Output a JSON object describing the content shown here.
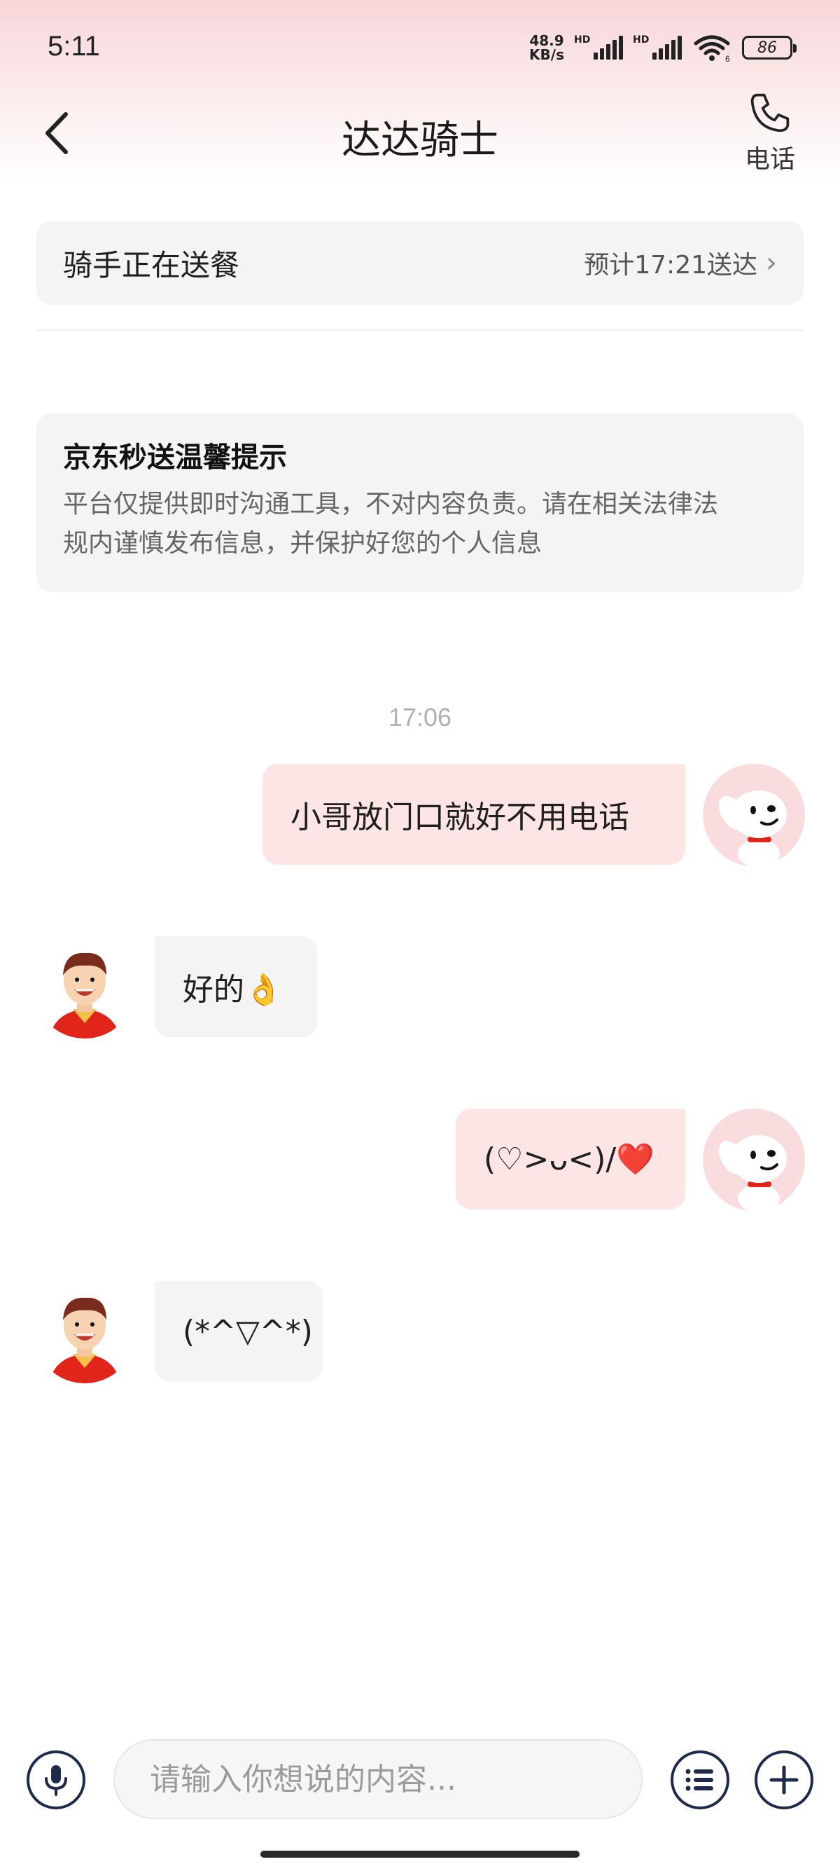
{
  "status_bar": {
    "time": "5:11",
    "net_speed_value": "48.9",
    "net_speed_unit": "KB/s",
    "signal_1_label": "HD",
    "signal_2_label": "HD",
    "wifi_badge": "6",
    "battery": "86"
  },
  "header": {
    "title": "达达骑士",
    "phone_label": "电话",
    "back_icon": "chevron-left-icon",
    "phone_icon": "phone-icon"
  },
  "delivery": {
    "status": "骑手正在送餐",
    "eta": "预计17:21送达",
    "arrow": "›"
  },
  "notice": {
    "title": "京东秒送温馨提示",
    "line1": "平台仅提供即时沟通工具，不对内容负责。请在相关法律法",
    "line2": "规内谨慎发布信息，并保护好您的个人信息"
  },
  "chat": {
    "timestamp": "17:06",
    "messages": [
      {
        "from": "user",
        "text": "小哥放门口就好不用电话"
      },
      {
        "from": "rider",
        "text": "好的👌"
      },
      {
        "from": "user",
        "text": "(♡>ᴗ<)/❤️"
      },
      {
        "from": "rider",
        "text": "(*^▽^*)"
      }
    ]
  },
  "input": {
    "placeholder": "请输入你想说的内容..."
  },
  "colors": {
    "bubble_out": "#fde4e5",
    "bubble_in": "#f4f4f4",
    "icon_stroke": "#1e2a4a",
    "brand_red": "#e1251b"
  }
}
